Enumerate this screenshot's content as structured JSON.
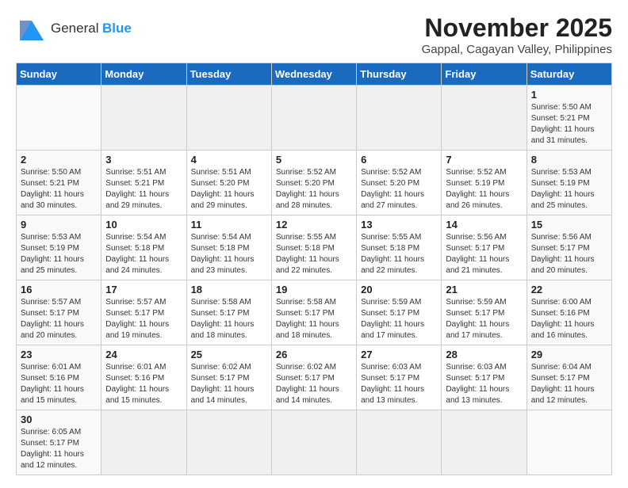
{
  "header": {
    "logo_line1": "General",
    "logo_line2": "Blue",
    "month_title": "November 2025",
    "location": "Gappal, Cagayan Valley, Philippines"
  },
  "days_of_week": [
    "Sunday",
    "Monday",
    "Tuesday",
    "Wednesday",
    "Thursday",
    "Friday",
    "Saturday"
  ],
  "weeks": [
    [
      {
        "day": "",
        "info": ""
      },
      {
        "day": "",
        "info": ""
      },
      {
        "day": "",
        "info": ""
      },
      {
        "day": "",
        "info": ""
      },
      {
        "day": "",
        "info": ""
      },
      {
        "day": "",
        "info": ""
      },
      {
        "day": "1",
        "info": "Sunrise: 5:50 AM\nSunset: 5:21 PM\nDaylight: 11 hours\nand 31 minutes."
      }
    ],
    [
      {
        "day": "2",
        "info": "Sunrise: 5:50 AM\nSunset: 5:21 PM\nDaylight: 11 hours\nand 30 minutes."
      },
      {
        "day": "3",
        "info": "Sunrise: 5:51 AM\nSunset: 5:21 PM\nDaylight: 11 hours\nand 29 minutes."
      },
      {
        "day": "4",
        "info": "Sunrise: 5:51 AM\nSunset: 5:20 PM\nDaylight: 11 hours\nand 29 minutes."
      },
      {
        "day": "5",
        "info": "Sunrise: 5:52 AM\nSunset: 5:20 PM\nDaylight: 11 hours\nand 28 minutes."
      },
      {
        "day": "6",
        "info": "Sunrise: 5:52 AM\nSunset: 5:20 PM\nDaylight: 11 hours\nand 27 minutes."
      },
      {
        "day": "7",
        "info": "Sunrise: 5:52 AM\nSunset: 5:19 PM\nDaylight: 11 hours\nand 26 minutes."
      },
      {
        "day": "8",
        "info": "Sunrise: 5:53 AM\nSunset: 5:19 PM\nDaylight: 11 hours\nand 25 minutes."
      }
    ],
    [
      {
        "day": "9",
        "info": "Sunrise: 5:53 AM\nSunset: 5:19 PM\nDaylight: 11 hours\nand 25 minutes."
      },
      {
        "day": "10",
        "info": "Sunrise: 5:54 AM\nSunset: 5:18 PM\nDaylight: 11 hours\nand 24 minutes."
      },
      {
        "day": "11",
        "info": "Sunrise: 5:54 AM\nSunset: 5:18 PM\nDaylight: 11 hours\nand 23 minutes."
      },
      {
        "day": "12",
        "info": "Sunrise: 5:55 AM\nSunset: 5:18 PM\nDaylight: 11 hours\nand 22 minutes."
      },
      {
        "day": "13",
        "info": "Sunrise: 5:55 AM\nSunset: 5:18 PM\nDaylight: 11 hours\nand 22 minutes."
      },
      {
        "day": "14",
        "info": "Sunrise: 5:56 AM\nSunset: 5:17 PM\nDaylight: 11 hours\nand 21 minutes."
      },
      {
        "day": "15",
        "info": "Sunrise: 5:56 AM\nSunset: 5:17 PM\nDaylight: 11 hours\nand 20 minutes."
      }
    ],
    [
      {
        "day": "16",
        "info": "Sunrise: 5:57 AM\nSunset: 5:17 PM\nDaylight: 11 hours\nand 20 minutes."
      },
      {
        "day": "17",
        "info": "Sunrise: 5:57 AM\nSunset: 5:17 PM\nDaylight: 11 hours\nand 19 minutes."
      },
      {
        "day": "18",
        "info": "Sunrise: 5:58 AM\nSunset: 5:17 PM\nDaylight: 11 hours\nand 18 minutes."
      },
      {
        "day": "19",
        "info": "Sunrise: 5:58 AM\nSunset: 5:17 PM\nDaylight: 11 hours\nand 18 minutes."
      },
      {
        "day": "20",
        "info": "Sunrise: 5:59 AM\nSunset: 5:17 PM\nDaylight: 11 hours\nand 17 minutes."
      },
      {
        "day": "21",
        "info": "Sunrise: 5:59 AM\nSunset: 5:17 PM\nDaylight: 11 hours\nand 17 minutes."
      },
      {
        "day": "22",
        "info": "Sunrise: 6:00 AM\nSunset: 5:16 PM\nDaylight: 11 hours\nand 16 minutes."
      }
    ],
    [
      {
        "day": "23",
        "info": "Sunrise: 6:01 AM\nSunset: 5:16 PM\nDaylight: 11 hours\nand 15 minutes."
      },
      {
        "day": "24",
        "info": "Sunrise: 6:01 AM\nSunset: 5:16 PM\nDaylight: 11 hours\nand 15 minutes."
      },
      {
        "day": "25",
        "info": "Sunrise: 6:02 AM\nSunset: 5:17 PM\nDaylight: 11 hours\nand 14 minutes."
      },
      {
        "day": "26",
        "info": "Sunrise: 6:02 AM\nSunset: 5:17 PM\nDaylight: 11 hours\nand 14 minutes."
      },
      {
        "day": "27",
        "info": "Sunrise: 6:03 AM\nSunset: 5:17 PM\nDaylight: 11 hours\nand 13 minutes."
      },
      {
        "day": "28",
        "info": "Sunrise: 6:03 AM\nSunset: 5:17 PM\nDaylight: 11 hours\nand 13 minutes."
      },
      {
        "day": "29",
        "info": "Sunrise: 6:04 AM\nSunset: 5:17 PM\nDaylight: 11 hours\nand 12 minutes."
      }
    ],
    [
      {
        "day": "30",
        "info": "Sunrise: 6:05 AM\nSunset: 5:17 PM\nDaylight: 11 hours\nand 12 minutes."
      },
      {
        "day": "",
        "info": ""
      },
      {
        "day": "",
        "info": ""
      },
      {
        "day": "",
        "info": ""
      },
      {
        "day": "",
        "info": ""
      },
      {
        "day": "",
        "info": ""
      },
      {
        "day": "",
        "info": ""
      }
    ]
  ]
}
